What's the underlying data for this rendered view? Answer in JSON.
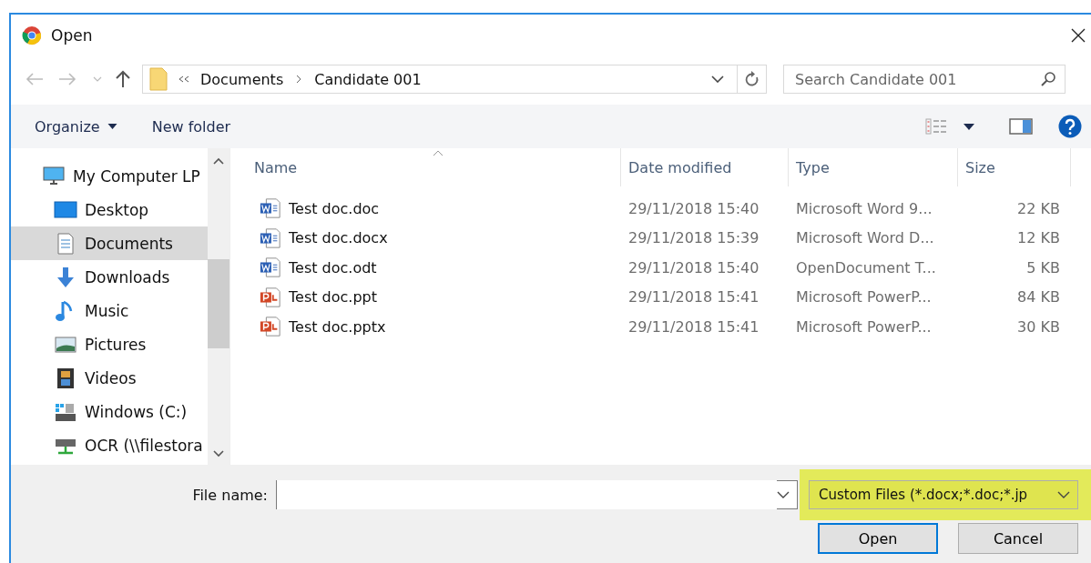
{
  "window": {
    "title": "Open"
  },
  "nav": {
    "path": [
      {
        "label": "Documents"
      },
      {
        "label": "Candidate 001"
      }
    ],
    "search": {
      "placeholder": "Search Candidate 001"
    }
  },
  "toolbar": {
    "items": [
      {
        "label": "Organize",
        "dropdown": true
      },
      {
        "label": "New folder",
        "dropdown": false
      }
    ]
  },
  "sidebar": {
    "items": [
      {
        "label": "My Computer LP",
        "kind": "computer",
        "selected": false,
        "children": [
          {
            "label": "Desktop",
            "kind": "desktop",
            "selected": false
          },
          {
            "label": "Documents",
            "kind": "documents",
            "selected": true
          },
          {
            "label": "Downloads",
            "kind": "downloads",
            "selected": false
          },
          {
            "label": "Music",
            "kind": "music",
            "selected": false
          },
          {
            "label": "Pictures",
            "kind": "pictures",
            "selected": false
          },
          {
            "label": "Videos",
            "kind": "videos",
            "selected": false
          },
          {
            "label": "Windows (C:)",
            "kind": "drive",
            "selected": false
          },
          {
            "label": "OCR (\\\\filestora",
            "kind": "network",
            "selected": false
          }
        ]
      }
    ]
  },
  "table": {
    "columns": [
      {
        "label": "Name"
      },
      {
        "label": "Date modified"
      },
      {
        "label": "Type"
      },
      {
        "label": "Size"
      }
    ],
    "rows": [
      {
        "kind": "word",
        "name": "Test doc.doc",
        "date": "29/11/2018 15:40",
        "type": "Microsoft Word 9...",
        "size": "22 KB"
      },
      {
        "kind": "word",
        "name": "Test doc.docx",
        "date": "29/11/2018 15:39",
        "type": "Microsoft Word D...",
        "size": "12 KB"
      },
      {
        "kind": "word",
        "name": "Test doc.odt",
        "date": "29/11/2018 15:40",
        "type": "OpenDocument T...",
        "size": "5 KB"
      },
      {
        "kind": "powerpoint",
        "name": "Test doc.ppt",
        "date": "29/11/2018 15:41",
        "type": "Microsoft PowerP...",
        "size": "84 KB"
      },
      {
        "kind": "powerpoint",
        "name": "Test doc.pptx",
        "date": "29/11/2018 15:41",
        "type": "Microsoft PowerP...",
        "size": "30 KB"
      }
    ]
  },
  "footer": {
    "file_name_label": "File name:",
    "filter": {
      "value": "Custom Files (*.docx;*.doc;*.jp",
      "highlighted": true
    },
    "buttons": [
      {
        "label": "Open",
        "default": true
      },
      {
        "label": "Cancel",
        "default": false
      }
    ]
  }
}
